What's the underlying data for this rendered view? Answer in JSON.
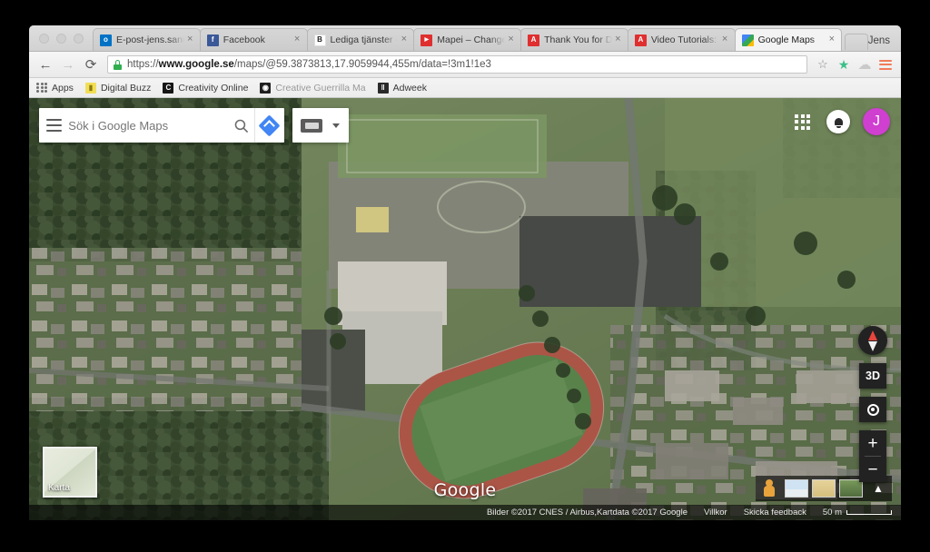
{
  "window": {
    "profile_name": "Jens",
    "traffic_lights": [
      "close",
      "minimize",
      "zoom"
    ]
  },
  "tabs": [
    {
      "title": "E-post-jens.sand@…",
      "favicon": "outlook-icon",
      "favicon_color": "#0072c6",
      "favicon_glyph": "o",
      "active": false
    },
    {
      "title": "Facebook",
      "favicon": "facebook-icon",
      "favicon_color": "#3b5998",
      "favicon_glyph": "f",
      "active": false
    },
    {
      "title": "Lediga tjänster - Bo…",
      "favicon": "blocket-icon",
      "favicon_color": "#ffffff",
      "favicon_glyph": "Β",
      "active": false
    },
    {
      "title": "Mapei – Change (Ly…",
      "favicon": "youtube-icon",
      "favicon_color": "#e02f2f",
      "favicon_glyph": "▶",
      "active": false
    },
    {
      "title": "Thank You for Down…",
      "favicon": "pdf-icon",
      "favicon_color": "#e02f2f",
      "favicon_glyph": "A",
      "active": false
    },
    {
      "title": "Video Tutorials: Get…",
      "favicon": "pdf-icon",
      "favicon_color": "#e02f2f",
      "favicon_glyph": "A",
      "active": false
    },
    {
      "title": "Google Maps",
      "favicon": "google-maps-icon",
      "favicon_color": "#34a853",
      "favicon_glyph": "",
      "active": true
    }
  ],
  "toolbar": {
    "back_label": "←",
    "forward_label": "→",
    "reload_label": "⟳",
    "url_scheme": "https://",
    "url_host": "www.google.se",
    "url_path": "/maps/@59.3873813,17.9059944,455m/data=!3m1!1e3",
    "bookmark_star": "☆",
    "extension_icon": "puzzle-extension-icon",
    "cloud_icon": "cloud-icon",
    "menu_icon": "hamburger-menu-icon"
  },
  "bookmarks": [
    {
      "label": "Apps",
      "icon": "apps-grid-icon",
      "color": "",
      "glyph": "",
      "faded": false
    },
    {
      "label": "Digital Buzz",
      "icon": "digital-buzz-icon",
      "color": "#f2de57",
      "glyph": "▬",
      "faded": false
    },
    {
      "label": "Creativity Online",
      "icon": "creativity-online-icon",
      "color": "#161616",
      "glyph": "C",
      "faded": false
    },
    {
      "label": "Creative Guerrilla Ma",
      "icon": "creative-guerrilla-icon",
      "color": "#1f1f1f",
      "glyph": "◉",
      "faded": true
    },
    {
      "label": "Adweek",
      "icon": "adweek-icon",
      "color": "#2a2a2a",
      "glyph": "‖",
      "faded": false
    }
  ],
  "map": {
    "search_placeholder": "Sök i Google Maps",
    "search_value": "",
    "hamburger_label": "menu",
    "search_icon": "search-icon",
    "directions_icon": "directions-icon",
    "print_icon": "print-icon",
    "print_caret": "chevron-down-icon",
    "apps_launcher": "apps-launcher-icon",
    "notifications": "bell-icon",
    "avatar_initial": "J",
    "avatar_color": "#cf3fd0",
    "google_watermark": "Google",
    "maptype_label": "Karta",
    "controls": {
      "compass": "compass-icon",
      "button_3d": "3D",
      "locate": "my-location-icon",
      "zoom_in": "+",
      "zoom_out": "−"
    },
    "street_view": {
      "pegman": "pegman-icon",
      "layers": [
        "map-layer-thumb",
        "terrain-layer-thumb",
        "satellite-layer-thumb"
      ],
      "expand": "chevron-up-icon"
    },
    "attribution": "Bilder ©2017 CNES / Airbus,Kartdata ©2017 Google",
    "terms_label": "Villkor",
    "feedback_label": "Skicka feedback",
    "scale_label": "50 m"
  }
}
